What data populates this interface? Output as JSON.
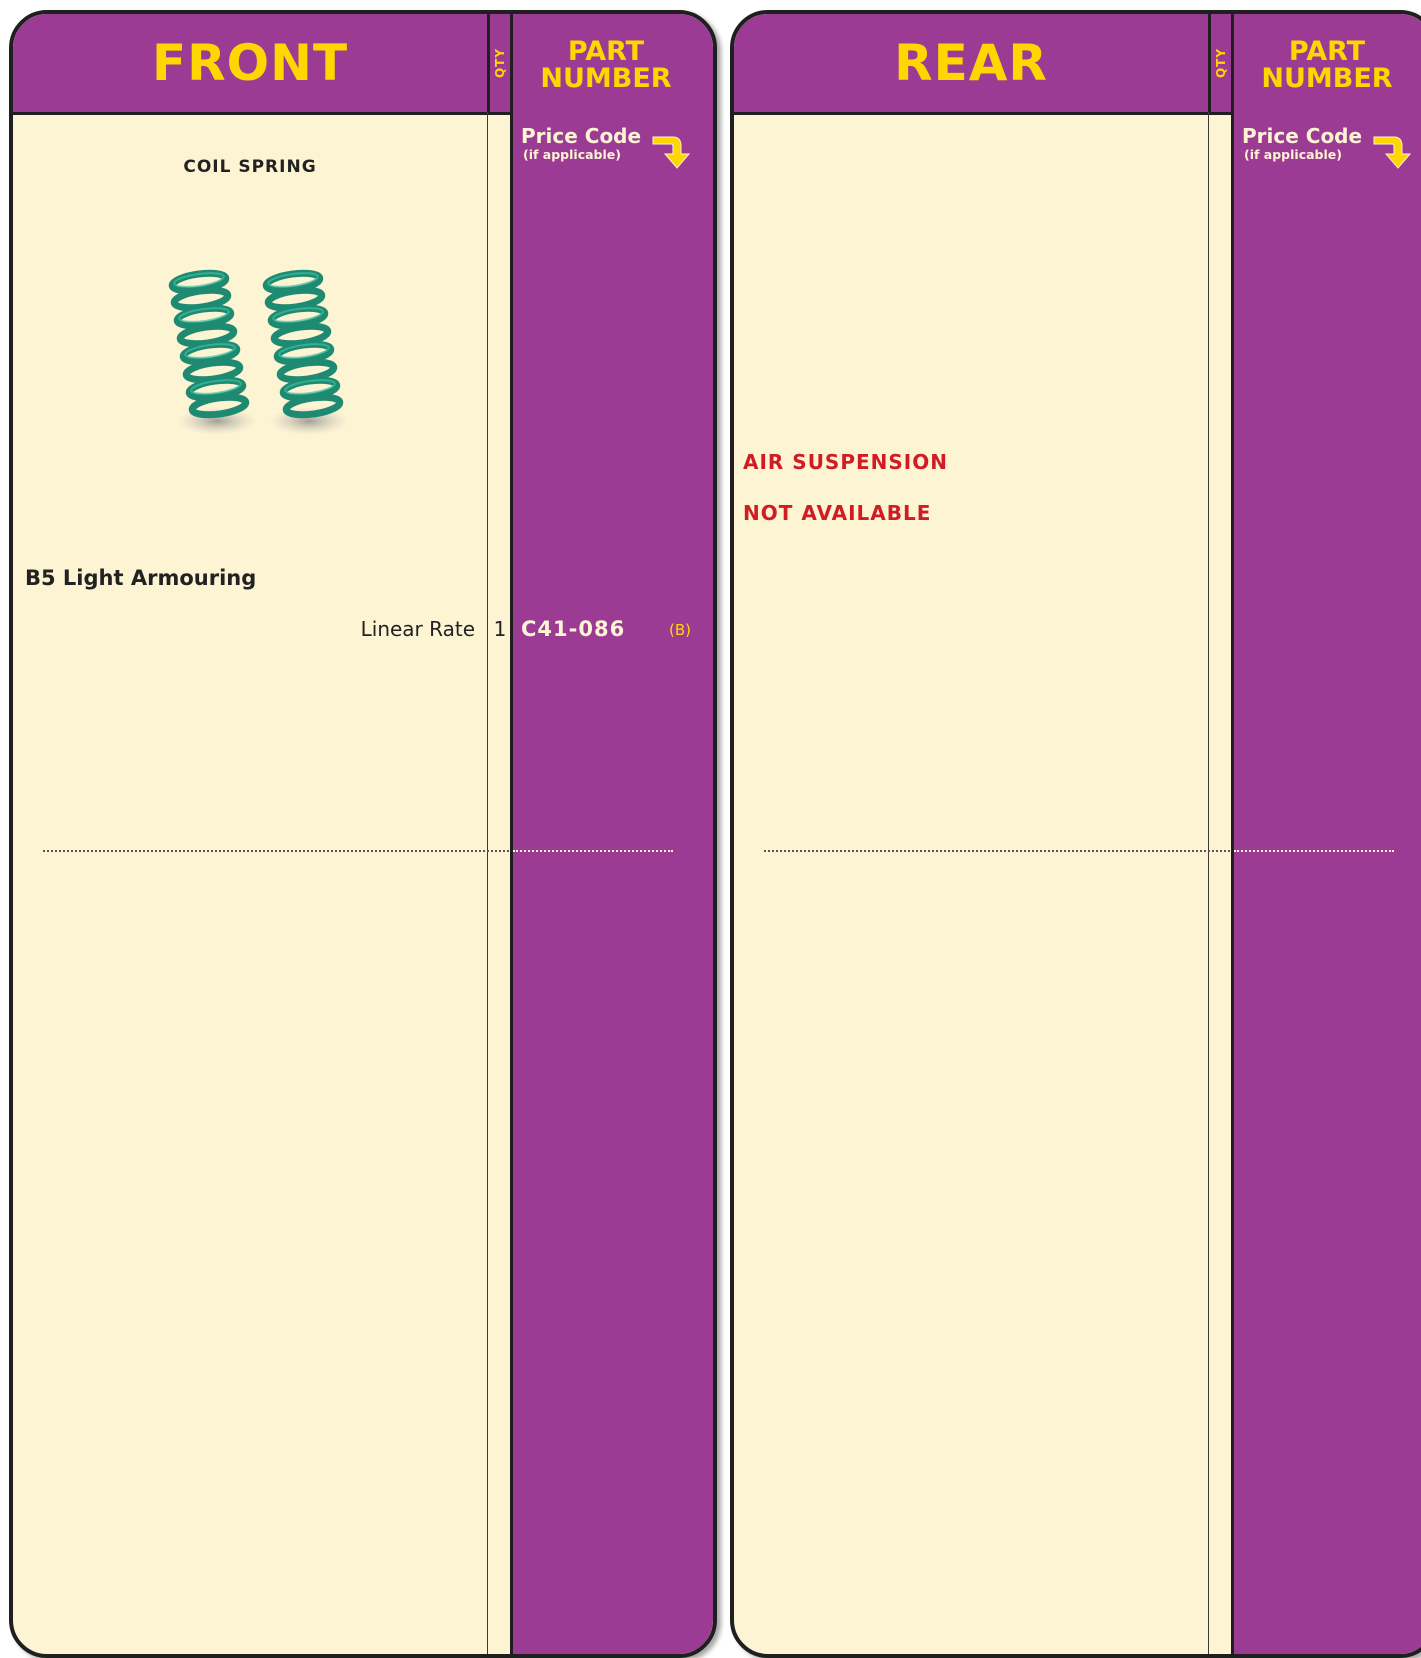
{
  "front": {
    "title": "FRONT",
    "qty_label": "QTY",
    "part_number_line1": "PART",
    "part_number_line2": "NUMBER",
    "price_code": "Price Code",
    "price_code_sub": "(if applicable)",
    "section_title": "COIL SPRING",
    "product_image": "coil-springs-image",
    "group_title": "B5 Light Armouring",
    "row": {
      "description": "Linear Rate",
      "qty": "1",
      "part_number": "C41-086",
      "price_code": "(B)"
    }
  },
  "rear": {
    "title": "REAR",
    "qty_label": "QTY",
    "part_number_line1": "PART",
    "part_number_line2": "NUMBER",
    "price_code": "Price Code",
    "price_code_sub": "(if applicable)",
    "notice_line1": "AIR SUSPENSION",
    "notice_line2": "NOT AVAILABLE"
  },
  "colors": {
    "purple": "#9b3b94",
    "yellow": "#ffd700",
    "cream": "#fdf4d4",
    "red": "#d01c22",
    "spring_green": "#1f8a72"
  }
}
